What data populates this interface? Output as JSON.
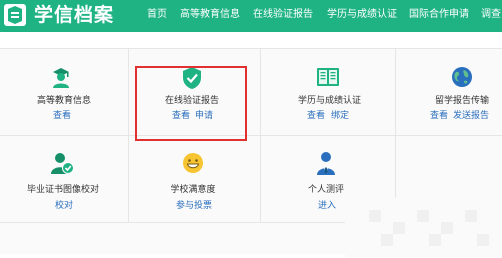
{
  "header": {
    "logo_text": "学信档案",
    "nav": [
      "首页",
      "高等教育信息",
      "在线验证报告",
      "学历与成绩认证",
      "国际合作申请",
      "调查"
    ]
  },
  "tiles": {
    "higher_ed": {
      "label": "高等教育信息",
      "links": [
        "查看"
      ]
    },
    "verify_report": {
      "label": "在线验证报告",
      "links": [
        "查看",
        "申请"
      ]
    },
    "degree_cert": {
      "label": "学历与成绩认证",
      "links": [
        "查看",
        "绑定"
      ]
    },
    "study_abroad": {
      "label": "留学报告传输",
      "links": [
        "查看",
        "发送报告"
      ]
    },
    "photo_check": {
      "label": "毕业证书图像校对",
      "links": [
        "校对"
      ]
    },
    "satisfaction": {
      "label": "学校满意度",
      "links": [
        "参与投票"
      ]
    },
    "personal_eval": {
      "label": "个人测评",
      "links": [
        "进入"
      ]
    }
  },
  "colors": {
    "brand_green": "#1fb384",
    "link_blue": "#2a6fbd",
    "highlight_red": "#e03030"
  }
}
